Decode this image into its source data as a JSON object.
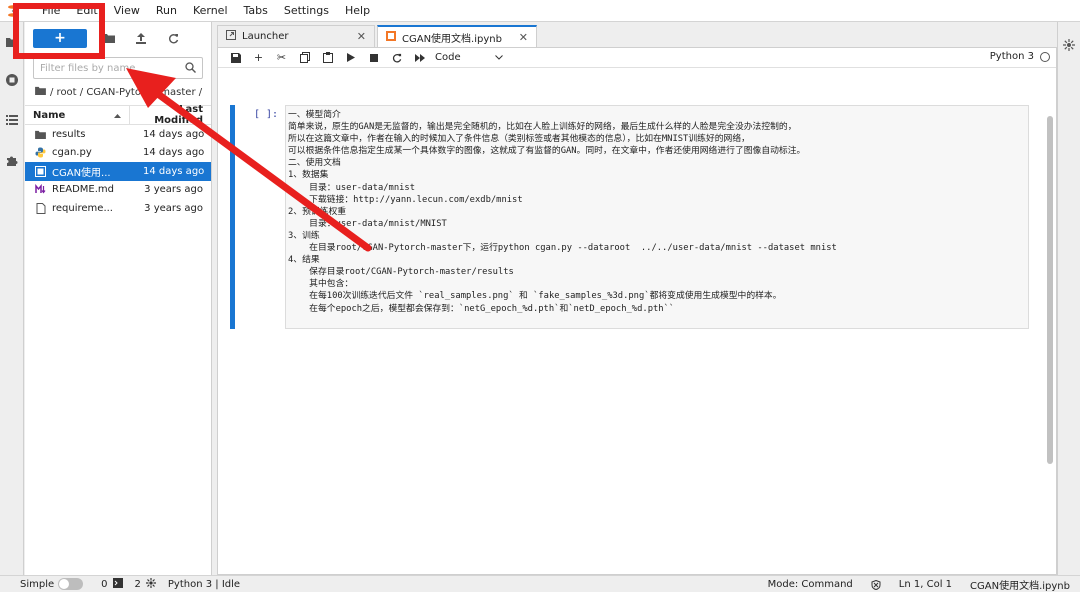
{
  "menubar": {
    "items": [
      "File",
      "Edit",
      "View",
      "Run",
      "Kernel",
      "Tabs",
      "Settings",
      "Help"
    ]
  },
  "filebrowser": {
    "new_label": "+",
    "search_placeholder": "Filter files by name",
    "breadcrumb": "/ root / CGAN-Pytorch-master /",
    "col_name": "Name",
    "col_modified": "Last Modified",
    "files": [
      {
        "name": "results",
        "modified": "14 days ago",
        "icon": "folder-icon"
      },
      {
        "name": "cgan.py",
        "modified": "14 days ago",
        "icon": "python-icon"
      },
      {
        "name": "CGAN使用...",
        "modified": "14 days ago",
        "icon": "notebook-icon",
        "selected": true
      },
      {
        "name": "README.md",
        "modified": "3 years ago",
        "icon": "markdown-icon"
      },
      {
        "name": "requireme...",
        "modified": "3 years ago",
        "icon": "file-icon"
      }
    ]
  },
  "tabs": [
    {
      "label": "Launcher",
      "active": false
    },
    {
      "label": "CGAN使用文档.ipynb",
      "active": true
    }
  ],
  "notebook": {
    "cell_type": "Code",
    "kernel": "Python 3",
    "prompt": "[ ]:",
    "lines": [
      "一、模型简介",
      "简单来说，原生的GAN是无监督的，输出是完全随机的，比如在人脸上训练好的网络，最后生成什么样的人脸是完全没办法控制的，",
      "所以在这篇文章中，作者在输入的时候加入了条件信息（类别标签或者其他模态的信息），比如在MNIST训练好的网络，",
      "可以根据条件信息指定生成某一个具体数字的图像，这就成了有监督的GAN。同时，在文章中，作者还使用网络进行了图像自动标注。",
      "二、使用文档",
      "1、数据集",
      "    目录：user-data/mnist",
      "    下载链接：http://yann.lecun.com/exdb/mnist",
      "2、预训练权重",
      "    目录：user-data/mnist/MNIST",
      "3、训练",
      "    在目录root/CGAN-Pytorch-master下，运行python cgan.py --dataroot  ../../user-data/mnist --dataset mnist",
      "4、结果",
      "    保存目录root/CGAN-Pytorch-master/results",
      "    其中包含：",
      "    在每100次训练迭代后文件 `real_samples.png` 和 `fake_samples_%3d.png`都将变成使用生成模型中的样本。",
      "    在每个epoch之后，模型都会保存到：`netG_epoch_%d.pth`和`netD_epoch_%d.pth``"
    ]
  },
  "statusbar": {
    "simple_label": "Simple",
    "terminals_count": "0",
    "kernels_count": "2",
    "kernel_status": "Python 3 | Idle",
    "mode": "Mode: Command",
    "position": "Ln 1, Col 1",
    "filename": "CGAN使用文档.ipynb"
  },
  "colors": {
    "accent": "#1976d2",
    "annotation": "#e8201e"
  }
}
